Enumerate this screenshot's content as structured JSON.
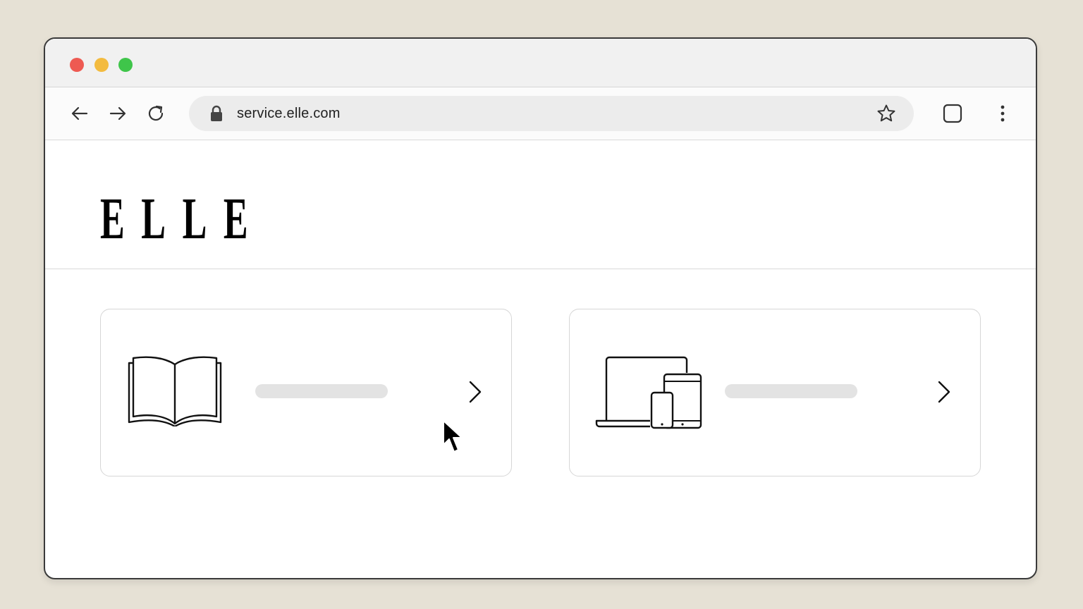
{
  "browser": {
    "url": "service.elle.com"
  },
  "site": {
    "logo_text": "ELLE"
  },
  "cards": [
    {
      "icon": "open-book-icon",
      "label_placeholder": true
    },
    {
      "icon": "devices-icon",
      "label_placeholder": true
    }
  ],
  "colors": {
    "background": "#e6e1d5",
    "traffic_red": "#ee5a52",
    "traffic_yellow": "#f3bb3f",
    "traffic_green": "#3fc54a"
  }
}
